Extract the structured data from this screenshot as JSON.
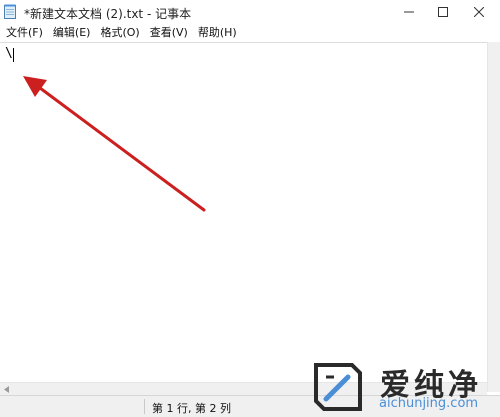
{
  "window": {
    "title": "*新建文本文档 (2).txt - 记事本"
  },
  "menu": {
    "items": [
      "文件(F)",
      "编辑(E)",
      "格式(O)",
      "查看(V)",
      "帮助(H)"
    ]
  },
  "editor": {
    "content": "\\"
  },
  "status": {
    "position": "第 1 行, 第 2 列"
  },
  "watermark": {
    "brand": "爱纯净",
    "url": "aichunjing.com"
  },
  "colors": {
    "annotation_arrow": "#cc1f1f",
    "watermark_blue": "#4a8fd6"
  },
  "icons": {
    "app": "notepad-icon",
    "minimize": "minimize-icon",
    "maximize": "maximize-icon",
    "close": "close-icon",
    "scroll_left": "scroll-left-arrow-icon"
  }
}
